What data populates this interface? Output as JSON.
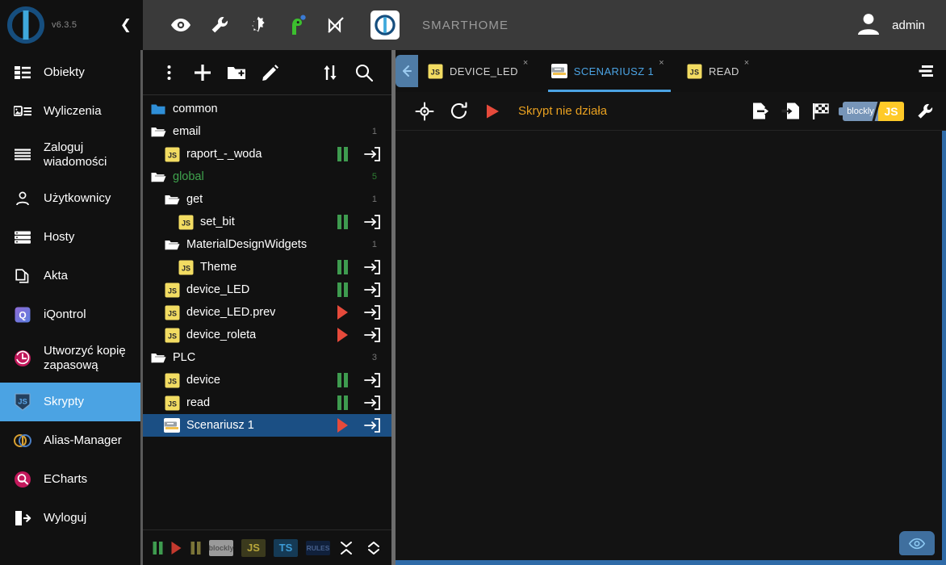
{
  "app": {
    "version": "v6.3.5",
    "brand_name": "SMARTHOME",
    "user": "admin",
    "accent": "#4BA3E3",
    "selected_row_color": "#1B4F84",
    "status_color": "#E8A020"
  },
  "sidebar": {
    "collapse_icon": "chevron-left-icon",
    "items": [
      {
        "label": "Obiekty",
        "icon": "list-objects-icon",
        "active": false
      },
      {
        "label": "Wyliczenia",
        "icon": "enums-icon",
        "active": false
      },
      {
        "label": "Zaloguj wiadomości",
        "icon": "log-icon",
        "active": false
      },
      {
        "label": "Użytkownicy",
        "icon": "user-icon",
        "active": false
      },
      {
        "label": "Hosty",
        "icon": "hosts-icon",
        "active": false
      },
      {
        "label": "Akta",
        "icon": "files-icon",
        "active": false
      },
      {
        "label": "iQontrol",
        "icon": "iqontrol-icon",
        "active": false
      },
      {
        "label": "Utworzyć kopię zapasową",
        "icon": "backup-clock-icon",
        "active": false
      },
      {
        "label": "Skrypty",
        "icon": "js-script-icon",
        "active": true
      },
      {
        "label": "Alias-Manager",
        "icon": "alias-icon",
        "active": false
      },
      {
        "label": "ECharts",
        "icon": "echarts-icon",
        "active": false
      },
      {
        "label": "Wyloguj",
        "icon": "logout-icon",
        "active": false
      }
    ]
  },
  "topbar": {
    "icons": [
      {
        "name": "eye-icon",
        "title": "eye"
      },
      {
        "name": "wrench-icon",
        "title": "wrench"
      },
      {
        "name": "brightness-icon",
        "title": "brightness"
      },
      {
        "name": "expert-mode-icon",
        "title": "expert-mode",
        "badge": true
      },
      {
        "name": "no-connection-icon",
        "title": "no-connection"
      }
    ],
    "logo": "iobroker-logo-icon",
    "brand": "SMARTHOME",
    "user_icon": "account-avatar-icon",
    "user": "admin"
  },
  "tree_toolbar": {
    "buttons": [
      {
        "name": "more-vert-icon",
        "label": "More"
      },
      {
        "name": "add-icon",
        "label": "Add script"
      },
      {
        "name": "new-folder-icon",
        "label": "New folder"
      },
      {
        "name": "edit-pencil-icon",
        "label": "Rename"
      },
      {
        "name": "expand-collapse-icon",
        "label": "Expand / collapse"
      },
      {
        "name": "search-icon",
        "label": "Search"
      }
    ]
  },
  "tree": {
    "rows": [
      {
        "name": "common",
        "type": "folder",
        "folder_state": "closed",
        "depth": 0,
        "count": "",
        "selected": false,
        "run": "",
        "color": "white"
      },
      {
        "name": "email",
        "type": "folder",
        "folder_state": "open",
        "depth": 0,
        "count": "1",
        "selected": false,
        "run": "",
        "color": "white"
      },
      {
        "name": "raport_-_woda",
        "type": "script",
        "script_kind": "js",
        "depth": 1,
        "count": "",
        "selected": false,
        "run": "pause",
        "color": "white"
      },
      {
        "name": "global",
        "type": "folder",
        "folder_state": "open",
        "depth": 0,
        "count": "5",
        "selected": false,
        "run": "",
        "color": "green"
      },
      {
        "name": "get",
        "type": "folder",
        "folder_state": "open",
        "depth": 1,
        "count": "1",
        "selected": false,
        "run": "",
        "color": "white"
      },
      {
        "name": "set_bit",
        "type": "script",
        "script_kind": "js",
        "depth": 2,
        "count": "",
        "selected": false,
        "run": "pause",
        "color": "white"
      },
      {
        "name": "MaterialDesignWidgets",
        "type": "folder",
        "folder_state": "open",
        "depth": 1,
        "count": "1",
        "selected": false,
        "run": "",
        "color": "white"
      },
      {
        "name": "Theme",
        "type": "script",
        "script_kind": "js",
        "depth": 2,
        "count": "",
        "selected": false,
        "run": "pause",
        "color": "white"
      },
      {
        "name": "device_LED",
        "type": "script",
        "script_kind": "js",
        "depth": 1,
        "count": "",
        "selected": false,
        "run": "pause",
        "color": "white"
      },
      {
        "name": "device_LED.prev",
        "type": "script",
        "script_kind": "js",
        "depth": 1,
        "count": "",
        "selected": false,
        "run": "play",
        "color": "white"
      },
      {
        "name": "device_roleta",
        "type": "script",
        "script_kind": "js",
        "depth": 1,
        "count": "",
        "selected": false,
        "run": "play",
        "color": "white"
      },
      {
        "name": "PLC",
        "type": "folder",
        "folder_state": "open",
        "depth": 0,
        "count": "3",
        "selected": false,
        "run": "",
        "color": "white"
      },
      {
        "name": "device",
        "type": "script",
        "script_kind": "js",
        "depth": 1,
        "count": "",
        "selected": false,
        "run": "pause",
        "color": "white"
      },
      {
        "name": "read",
        "type": "script",
        "script_kind": "js",
        "depth": 1,
        "count": "",
        "selected": false,
        "run": "pause",
        "color": "white"
      },
      {
        "name": "Scenariusz 1",
        "type": "script",
        "script_kind": "blockly",
        "depth": 1,
        "count": "",
        "selected": true,
        "run": "play",
        "color": "white"
      }
    ]
  },
  "tree_footer": {
    "filters": [
      {
        "name": "filter-running-pause",
        "kind": "pause-green",
        "label": ""
      },
      {
        "name": "filter-stopped-play",
        "kind": "play-red",
        "label": ""
      },
      {
        "name": "filter-paused-olive",
        "kind": "pause-olive",
        "label": ""
      },
      {
        "name": "filter-blockly",
        "kind": "chip-blockly",
        "label": "blockly"
      },
      {
        "name": "filter-javascript",
        "kind": "chip-js",
        "label": "JS"
      },
      {
        "name": "filter-typescript",
        "kind": "chip-ts",
        "label": "TS"
      },
      {
        "name": "filter-rules",
        "kind": "chip-rules",
        "label": "RULES"
      }
    ],
    "collapse_all": "collapse-all-icon",
    "expand_all": "expand-all-icon"
  },
  "tabs": {
    "back_icon": "arrow-left-icon",
    "menu_icon": "tab-list-icon",
    "items": [
      {
        "label": "DEVICE_LED",
        "kind": "js",
        "active": false,
        "close": "×"
      },
      {
        "label": "SCENARIUSZ 1",
        "kind": "blockly",
        "active": true,
        "close": "×"
      },
      {
        "label": "READ",
        "kind": "js",
        "active": false,
        "close": "×"
      }
    ]
  },
  "editor_toolbar": {
    "left": [
      {
        "name": "locate-script-icon",
        "label": "Locate"
      },
      {
        "name": "reload-icon",
        "label": "Reload"
      },
      {
        "name": "run-play-icon",
        "label": "Run"
      }
    ],
    "status": "Skrypt nie działa",
    "right": [
      {
        "name": "export-file-icon",
        "label": "Export"
      },
      {
        "name": "import-file-icon",
        "label": "Import"
      },
      {
        "name": "debug-flag-icon",
        "label": "Debug"
      }
    ],
    "language_toggle": {
      "left_label": "blockly",
      "right_label": "JS",
      "selected": "blockly"
    },
    "settings_icon": "wrench-settings-icon"
  },
  "editor": {
    "canvas_content": "",
    "eye_button": "toggle-preview-eye-icon"
  }
}
